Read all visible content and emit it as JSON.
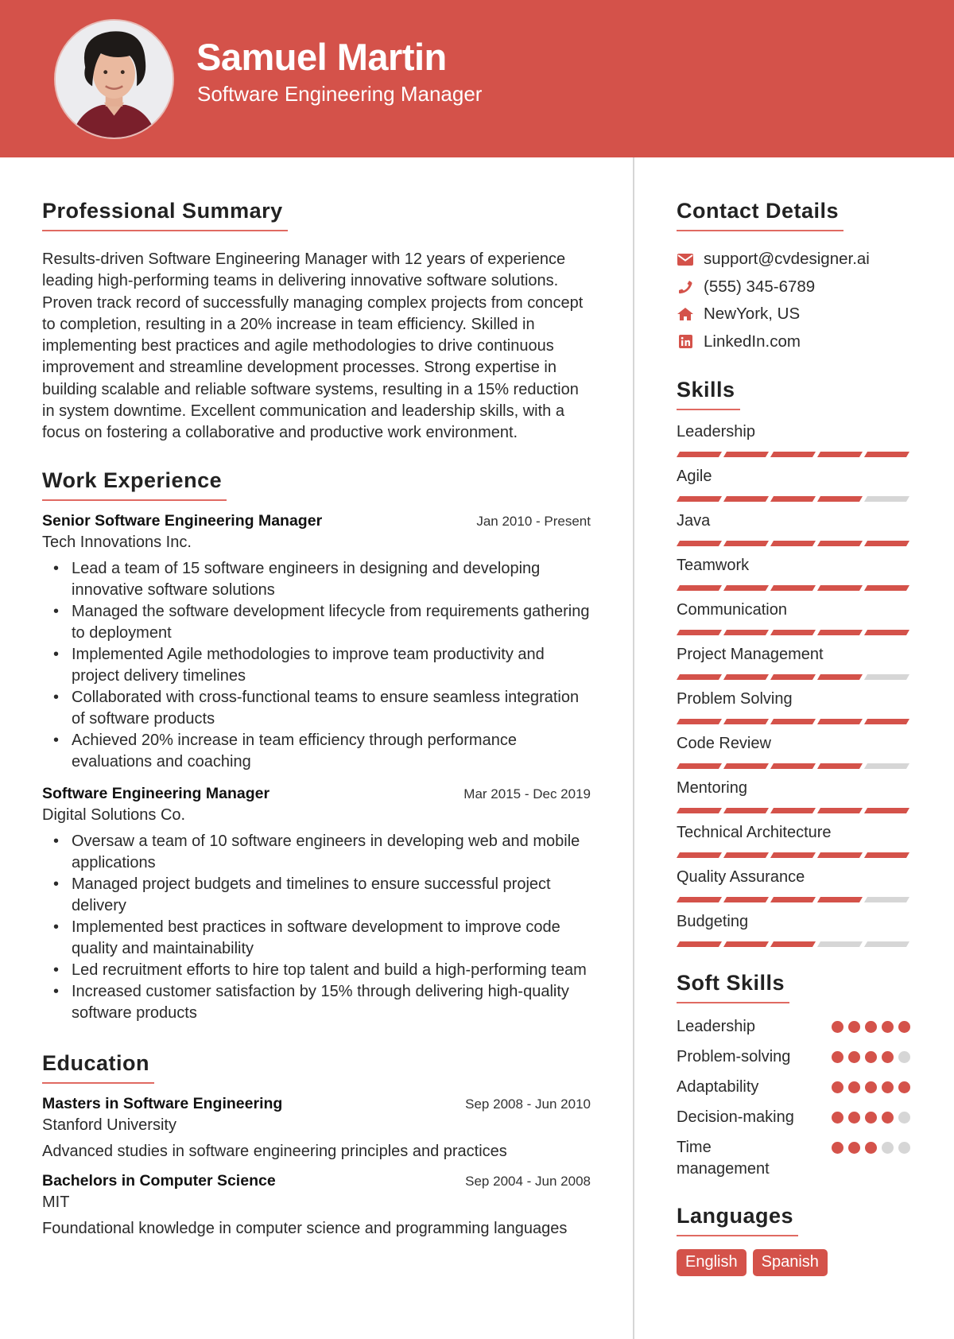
{
  "header": {
    "name": "Samuel Martin",
    "title": "Software Engineering Manager",
    "photo": "profile-photo"
  },
  "colors": {
    "accent": "#d4524a",
    "inactive": "#d6d6d6",
    "text": "#2b2b2b"
  },
  "summary": {
    "heading": "Professional Summary",
    "text": "Results-driven Software Engineering Manager with 12 years of experience leading high-performing teams in delivering innovative software solutions. Proven track record of successfully managing complex projects from concept to completion, resulting in a 20% increase in team efficiency. Skilled in implementing best practices and agile methodologies to drive continuous improvement and streamline development processes. Strong expertise in building scalable and reliable software systems, resulting in a 15% reduction in system downtime. Excellent communication and leadership skills, with a focus on fostering a collaborative and productive work environment."
  },
  "experience": {
    "heading": "Work Experience",
    "jobs": [
      {
        "title": "Senior Software Engineering Manager",
        "dates": "Jan 2010 - Present",
        "company": "Tech Innovations Inc.",
        "bullets": [
          "Lead a team of 15 software engineers in designing and developing innovative software solutions",
          "Managed the software development lifecycle from requirements gathering to deployment",
          "Implemented Agile methodologies to improve team productivity and project delivery timelines",
          "Collaborated with cross-functional teams to ensure seamless integration of software products",
          "Achieved 20% increase in team efficiency through performance evaluations and coaching"
        ]
      },
      {
        "title": "Software Engineering Manager",
        "dates": "Mar 2015 - Dec 2019",
        "company": "Digital Solutions Co.",
        "bullets": [
          "Oversaw a team of 10 software engineers in developing web and mobile applications",
          "Managed project budgets and timelines to ensure successful project delivery",
          "Implemented best practices in software development to improve code quality and maintainability",
          "Led recruitment efforts to hire top talent and build a high-performing team",
          "Increased customer satisfaction by 15% through delivering high-quality software products"
        ]
      }
    ]
  },
  "education": {
    "heading": "Education",
    "items": [
      {
        "degree": "Masters in Software Engineering",
        "dates": "Sep 2008 - Jun 2010",
        "school": "Stanford University",
        "description": "Advanced studies in software engineering principles and practices"
      },
      {
        "degree": "Bachelors in Computer Science",
        "dates": "Sep 2004 - Jun 2008",
        "school": "MIT",
        "description": "Foundational knowledge in computer science and programming languages"
      }
    ]
  },
  "contact": {
    "heading": "Contact Details",
    "items": [
      {
        "icon": "envelope-icon",
        "text": "support@cvdesigner.ai"
      },
      {
        "icon": "phone-icon",
        "text": "(555) 345-6789"
      },
      {
        "icon": "home-icon",
        "text": "NewYork, US"
      },
      {
        "icon": "linkedin-icon",
        "text": "LinkedIn.com"
      }
    ]
  },
  "skills": {
    "heading": "Skills",
    "max": 5,
    "items": [
      {
        "name": "Leadership",
        "level": 5
      },
      {
        "name": "Agile",
        "level": 4
      },
      {
        "name": "Java",
        "level": 5
      },
      {
        "name": "Teamwork",
        "level": 5
      },
      {
        "name": "Communication",
        "level": 5
      },
      {
        "name": "Project Management",
        "level": 4
      },
      {
        "name": "Problem Solving",
        "level": 5
      },
      {
        "name": "Code Review",
        "level": 4
      },
      {
        "name": "Mentoring",
        "level": 5
      },
      {
        "name": "Technical Architecture",
        "level": 5
      },
      {
        "name": "Quality Assurance",
        "level": 4
      },
      {
        "name": "Budgeting",
        "level": 3
      }
    ]
  },
  "soft_skills": {
    "heading": "Soft Skills",
    "max": 5,
    "items": [
      {
        "name": "Leadership",
        "level": 5
      },
      {
        "name": "Problem-solving",
        "level": 4
      },
      {
        "name": "Adaptability",
        "level": 5
      },
      {
        "name": "Decision-making",
        "level": 4
      },
      {
        "name": "Time management",
        "level": 3
      }
    ]
  },
  "languages": {
    "heading": "Languages",
    "items": [
      "English",
      "Spanish"
    ]
  }
}
